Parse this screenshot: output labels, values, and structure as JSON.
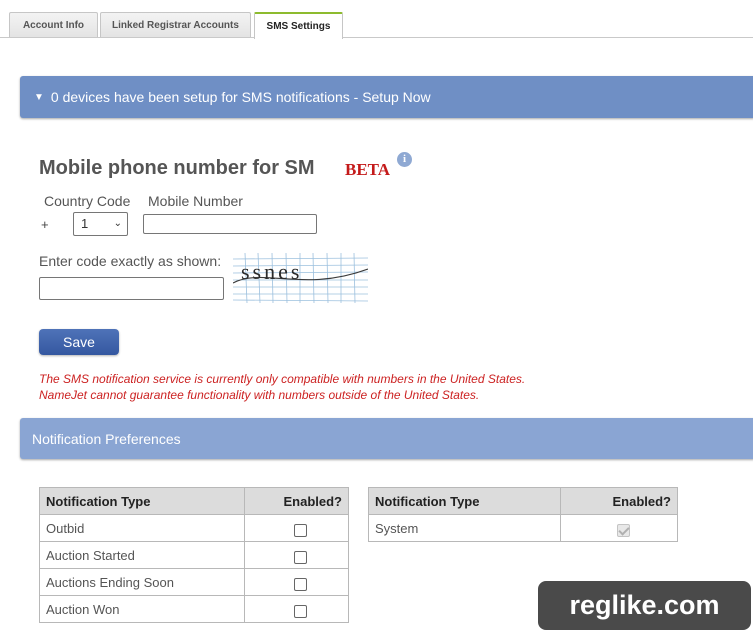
{
  "tabs": [
    {
      "label": "Account Info",
      "active": false
    },
    {
      "label": "Linked Registrar Accounts",
      "active": false
    },
    {
      "label": "SMS Settings",
      "active": true
    }
  ],
  "sms_bar": {
    "text": "0 devices have been setup for SMS notifications - Setup Now",
    "icon": "caret-down-icon"
  },
  "form": {
    "heading": "Mobile phone number for SM",
    "beta": "BETA",
    "info_icon": "i",
    "country_code_label": "Country Code",
    "mobile_number_label": "Mobile Number",
    "plus": "+",
    "country_code_value": "1",
    "mobile_number_value": "",
    "captcha_label": "Enter code exactly as shown:",
    "captcha_text": "ssnes",
    "captcha_value": "",
    "save_label": "Save",
    "warning_line1": "The SMS notification service is currently only compatible with numbers in the United States.",
    "warning_line2": "NameJet cannot guarantee functionality with numbers outside of the United States."
  },
  "preferences": {
    "title": "Notification Preferences",
    "left_table": {
      "headers": [
        "Notification Type",
        "Enabled?"
      ],
      "rows": [
        {
          "type": "Outbid",
          "enabled": false
        },
        {
          "type": "Auction Started",
          "enabled": false
        },
        {
          "type": "Auctions Ending Soon",
          "enabled": false
        },
        {
          "type": "Auction Won",
          "enabled": false
        }
      ]
    },
    "right_table": {
      "headers": [
        "Notification Type",
        "Enabled?"
      ],
      "rows": [
        {
          "type": "System",
          "enabled": true,
          "disabled": true
        }
      ]
    }
  },
  "watermark": "reglike.com",
  "colors": {
    "bar_blue": "#6f8fc5",
    "button_blue": "#3457a0",
    "warning_red": "#cc2222",
    "beta_red": "#c41a1a",
    "tab_accent": "#8dbb2e"
  }
}
